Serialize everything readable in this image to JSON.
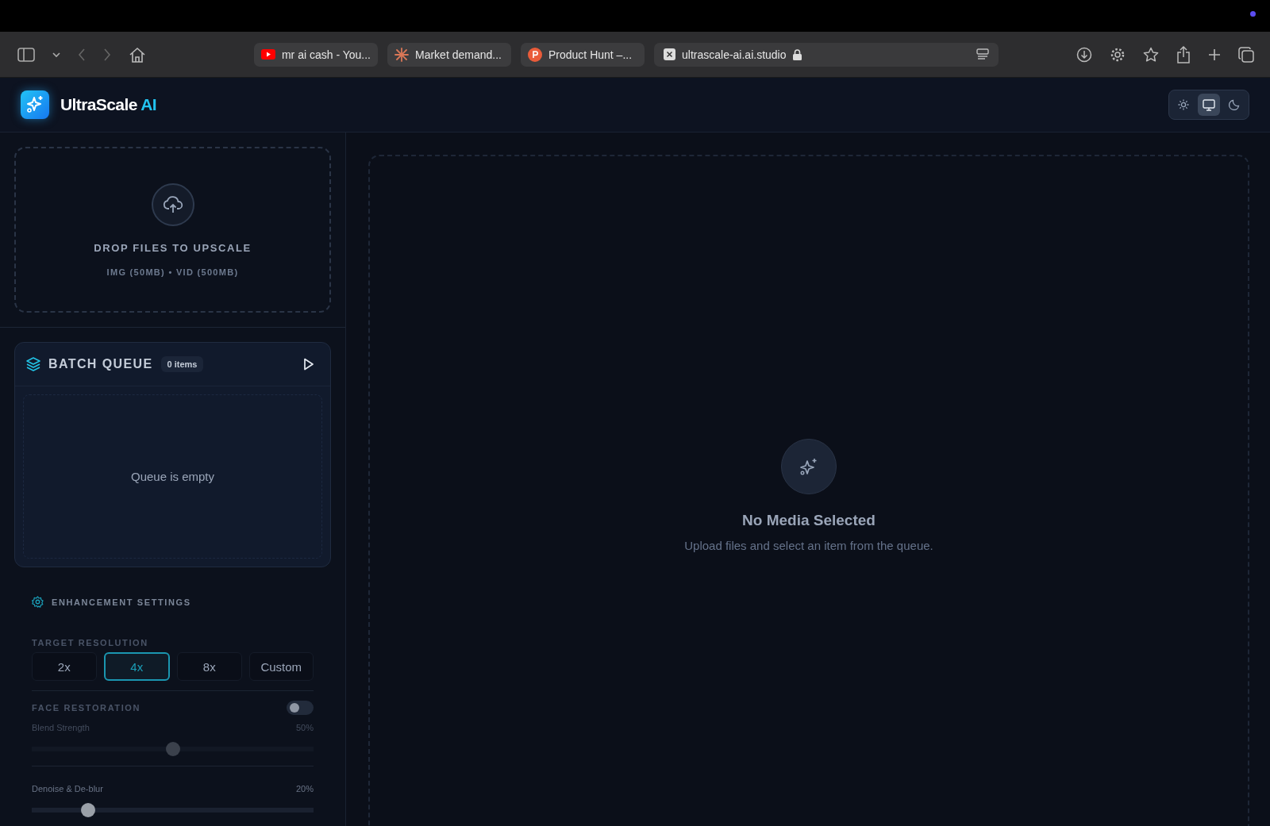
{
  "browser": {
    "tabs": [
      {
        "title": "mr ai cash - You...",
        "kind": "video",
        "selected": false
      },
      {
        "title": "Market demand...",
        "kind": "burst",
        "selected": false
      },
      {
        "title": "Product Hunt –...",
        "kind": "letter",
        "selected": false
      },
      {
        "title": "ultrascale-ai.ai.studio",
        "kind": "close",
        "selected": true
      }
    ]
  },
  "app": {
    "brand": "UltraScale",
    "brand_accent": "AI",
    "theme_options": [
      {
        "kind": "light",
        "selected": false
      },
      {
        "kind": "system",
        "selected": true
      },
      {
        "kind": "dark",
        "selected": false
      }
    ]
  },
  "dropzone": {
    "title": "DROP FILES TO UPSCALE",
    "subtitle": "IMG (50MB) • VID (500MB)"
  },
  "batch_queue": {
    "title": "BATCH QUEUE",
    "count": "0 items",
    "empty_text": "Queue is empty"
  },
  "settings": {
    "title": "ENHANCEMENT SETTINGS",
    "resolution_label": "TARGET RESOLUTION",
    "resolutions": [
      {
        "label": "2x",
        "selected": false
      },
      {
        "label": "4x",
        "selected": true
      },
      {
        "label": "8x",
        "selected": false
      },
      {
        "label": "Custom",
        "selected": false
      }
    ],
    "face_restoration": {
      "label": "FACE RESTORATION",
      "on": false
    },
    "sliders": [
      {
        "label": "Blend Strength",
        "reading": "50%",
        "level": 0.5,
        "disabled": true
      },
      {
        "label": "Denoise & De-blur",
        "reading": "20%",
        "level": 0.2,
        "disabled": false
      }
    ]
  },
  "preview": {
    "title": "No Media Selected",
    "subtitle": "Upload files and select an item from the queue."
  }
}
